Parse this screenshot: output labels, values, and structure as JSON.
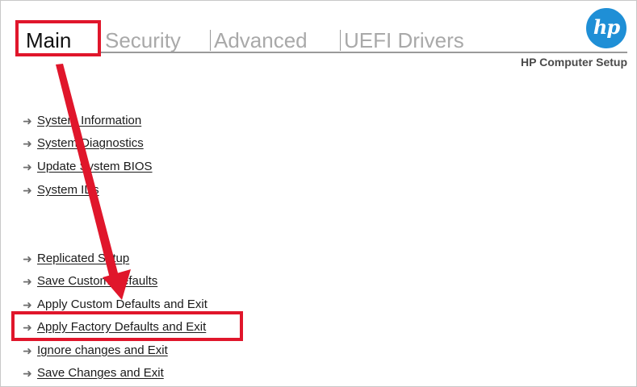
{
  "header": {
    "tabs": [
      {
        "label": "Main",
        "active": true
      },
      {
        "label": "Security",
        "active": false
      },
      {
        "label": "Advanced",
        "active": false
      },
      {
        "label": "UEFI Drivers",
        "active": false
      }
    ],
    "subtitle": "HP Computer Setup",
    "logo_text": "hp"
  },
  "menu": {
    "group1": [
      {
        "label": "System Information"
      },
      {
        "label": "System Diagnostics"
      },
      {
        "label": "Update System BIOS"
      },
      {
        "label": "System IDs"
      }
    ],
    "group2": [
      {
        "label": "Replicated Setup"
      },
      {
        "label": "Save Custom Defaults"
      },
      {
        "label": "Apply Custom Defaults and Exit"
      },
      {
        "label": "Apply Factory Defaults and Exit"
      },
      {
        "label": "Ignore changes and Exit"
      },
      {
        "label": "Save Changes and Exit"
      }
    ]
  },
  "colors": {
    "annotation": "#e0162b",
    "logo": "#1f8fd6",
    "active_tab": "#111111",
    "inactive_tab": "#a9a9a9"
  }
}
